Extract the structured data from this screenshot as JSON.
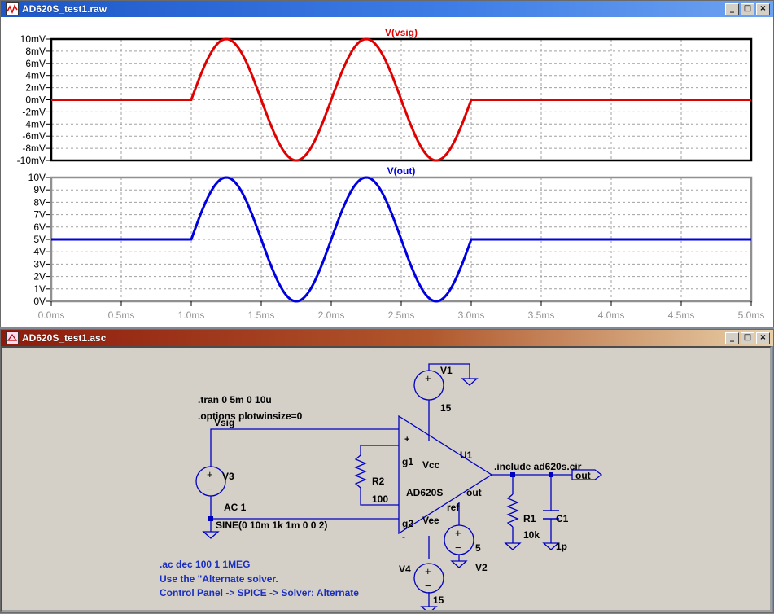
{
  "plot_window": {
    "title": "AD620S_test1.raw",
    "buttons": {
      "minimize": "_",
      "restore": "□",
      "close": "×"
    }
  },
  "schematic_window": {
    "title": "AD620S_test1.asc",
    "buttons": {
      "minimize": "_",
      "restore": "□",
      "close": "×"
    }
  },
  "chart_data": [
    {
      "type": "line",
      "title": "V(vsig)",
      "series": [
        {
          "name": "V(vsig)",
          "color": "#e00000",
          "x_ms": [
            0,
            1.0,
            1.25,
            1.5,
            1.75,
            2.0,
            2.25,
            2.5,
            2.75,
            3.0,
            5.0
          ],
          "y_mV": [
            0,
            0,
            10,
            0,
            -10,
            0,
            10,
            0,
            -10,
            0,
            0
          ]
        }
      ],
      "ylim": [
        -10,
        10
      ],
      "xlim": [
        0,
        5
      ],
      "y_ticks": [
        "10mV",
        "8mV",
        "6mV",
        "4mV",
        "2mV",
        "0mV",
        "-2mV",
        "-4mV",
        "-6mV",
        "-8mV",
        "-10mV"
      ],
      "grid": true
    },
    {
      "type": "line",
      "title": "V(out)",
      "series": [
        {
          "name": "V(out)",
          "color": "#0000e0",
          "x_ms": [
            0,
            1.0,
            1.25,
            1.5,
            1.75,
            2.0,
            2.25,
            2.5,
            2.75,
            3.0,
            5.0
          ],
          "y_V": [
            5,
            5,
            10,
            5,
            0,
            5,
            10,
            5,
            0,
            5,
            5
          ]
        }
      ],
      "ylim": [
        0,
        10
      ],
      "xlim": [
        0,
        5
      ],
      "y_ticks": [
        "10V",
        "9V",
        "8V",
        "7V",
        "6V",
        "5V",
        "4V",
        "3V",
        "2V",
        "1V",
        "0V"
      ],
      "x_ticks": [
        "0.0ms",
        "0.5ms",
        "1.0ms",
        "1.5ms",
        "2.0ms",
        "2.5ms",
        "3.0ms",
        "3.5ms",
        "4.0ms",
        "4.5ms",
        "5.0ms"
      ],
      "grid": true
    }
  ],
  "schematic": {
    "directives": [
      ".tran 0 5m 0 10u",
      ".options plotwinsize=0"
    ],
    "include": ".include ad620s.cir",
    "ac_lines": [
      ".ac dec 100 1 1MEG",
      "Use the \"Alternate solver.",
      "Control Panel -> SPICE -> Solver: Alternate"
    ],
    "net_vsig": "Vsig",
    "net_out": "out",
    "v1_name": "V1",
    "v1_value": "15",
    "v4_name": "V4",
    "v4_value": "15",
    "v3_name": "V3",
    "v3_ac": "AC 1",
    "v3_sine": "SINE(0 10m 1k 1m 0 0 2)",
    "v2_name": "V2",
    "v2_value": "5",
    "u1_name": "U1",
    "u1_part": "AD620S",
    "r2_name": "R2",
    "r2_value": "100",
    "r1_name": "R1",
    "r1_value": "10k",
    "c1_name": "C1",
    "c1_value": "1p",
    "pins": {
      "plus": "+",
      "minus": "-",
      "g1": "g1",
      "g2": "g2",
      "vcc": "Vcc",
      "vee": "Vee",
      "ref": "ref",
      "out": "out"
    },
    "colors": {
      "wire": "#0000c0",
      "ac_text": "#1a2ec0"
    }
  }
}
